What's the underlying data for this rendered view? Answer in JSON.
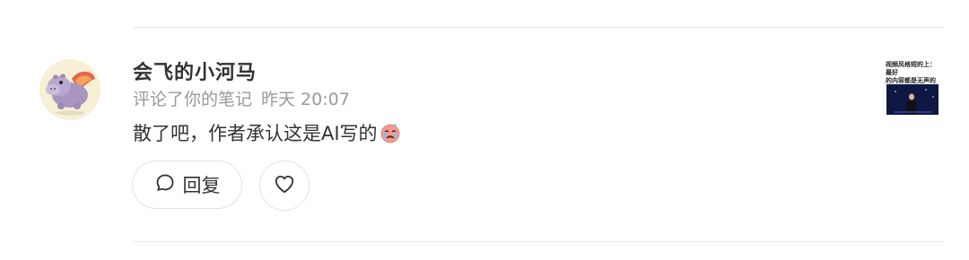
{
  "notification": {
    "username": "会飞的小河马",
    "action": "评论了你的笔记",
    "time": "昨天 20:07",
    "comment_text": "散了吧，作者承认这是AI写的",
    "comment_emoji": "crying-face-emoji",
    "avatar_icon": "hippo-with-wings",
    "reply_label": "回复",
    "reply_icon": "chat-bubble-icon",
    "like_icon": "heart-outline-icon",
    "thumbnail": {
      "text": "视频风格短的上：最好\n的内容都是无声的"
    }
  },
  "colors": {
    "primary_text": "#333333",
    "secondary_text": "#9a9a9a",
    "border": "#e2e2e2",
    "divider": "#e9e9e9"
  }
}
